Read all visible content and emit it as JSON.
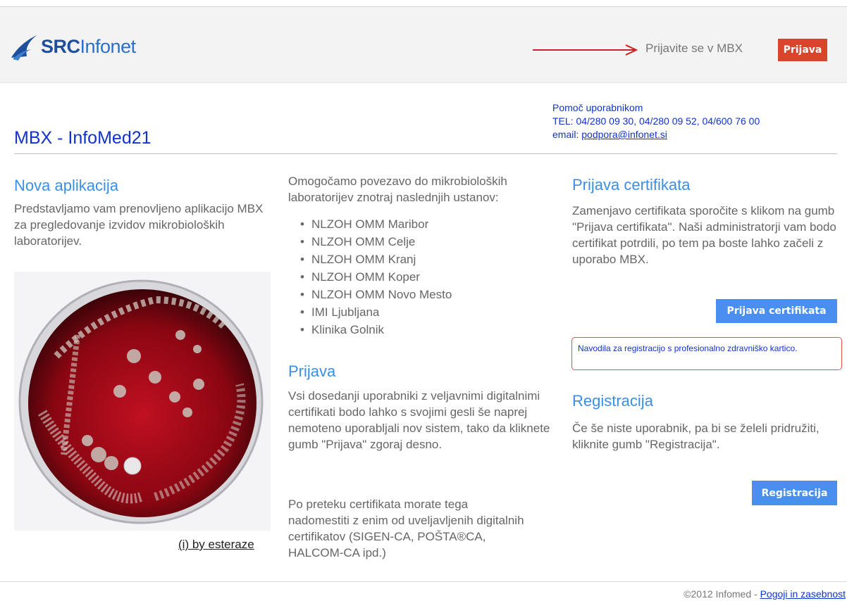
{
  "header": {
    "logo_src": "SRC",
    "logo_infonet": "Infonet",
    "login_prompt": "Prijavite se v MBX",
    "login_button": "Prijava"
  },
  "title": "MBX - InfoMed21",
  "help": {
    "heading": "Pomoč uporabnikom",
    "tel": "TEL: 04/280 09 30, 04/280 09 52, 04/600 76 00",
    "email_label": "email:",
    "email": "podpora@infonet.si"
  },
  "col1": {
    "heading": "Nova aplikacija",
    "text": "Predstavljamo vam prenovljeno aplikacijo MBX za pregledovanje izvidov mikrobioloških laboratorijev.",
    "credit": "(i) by esteraze"
  },
  "col2": {
    "intro": "Omogočamo povezavo do mikrobioloških laboratorijev znotraj naslednjih ustanov:",
    "institutions": [
      "NLZOH OMM Maribor",
      "NLZOH OMM Celje",
      "NLZOH OMM Kranj",
      "NLZOH OMM Koper",
      "NLZOH OMM Novo Mesto",
      "IMI Ljubljana",
      "Klinika Golnik"
    ],
    "prijava_heading": "Prijava",
    "prijava_text": "Vsi dosedanji uporabniki z veljavnimi digitalnimi certifikati bodo lahko s svojimi gesli še naprej nemoteno uporabljali nov sistem, tako da kliknete gumb \"Prijava\" zgoraj desno.",
    "prijava_text2": "Po preteku certifikata morate tega nadomestiti z enim od uveljavljenih digitalnih certifikatov (SIGEN-CA, POŠTA®CA, HALCOM-CA ipd.)"
  },
  "col3": {
    "cert_heading": "Prijava certifikata",
    "cert_text": "Zamenjavo certifikata sporočite s klikom na gumb \"Prijava certifikata\". Naši administratorji vam bodo certifikat potrdili, po tem pa boste lahko začeli z uporabo MBX.",
    "cert_button": "Prijava certifikata",
    "notice": "Navodila za registracijo s profesionalno zdravniško kartico.",
    "reg_heading": "Registracija",
    "reg_text": "Če še niste uporabnik, pa bi se želeli pridružiti, kliknite gumb \"Registracija\".",
    "reg_button": "Registracija"
  },
  "footer": {
    "copyright": "©2012 Infomed - ",
    "terms": "Pogoji in zasebnost"
  },
  "colors": {
    "accent_red": "#d9452c",
    "button_blue": "#4a8ff0",
    "heading_blue": "#3a8ee6",
    "link_blue": "#1133cc"
  }
}
